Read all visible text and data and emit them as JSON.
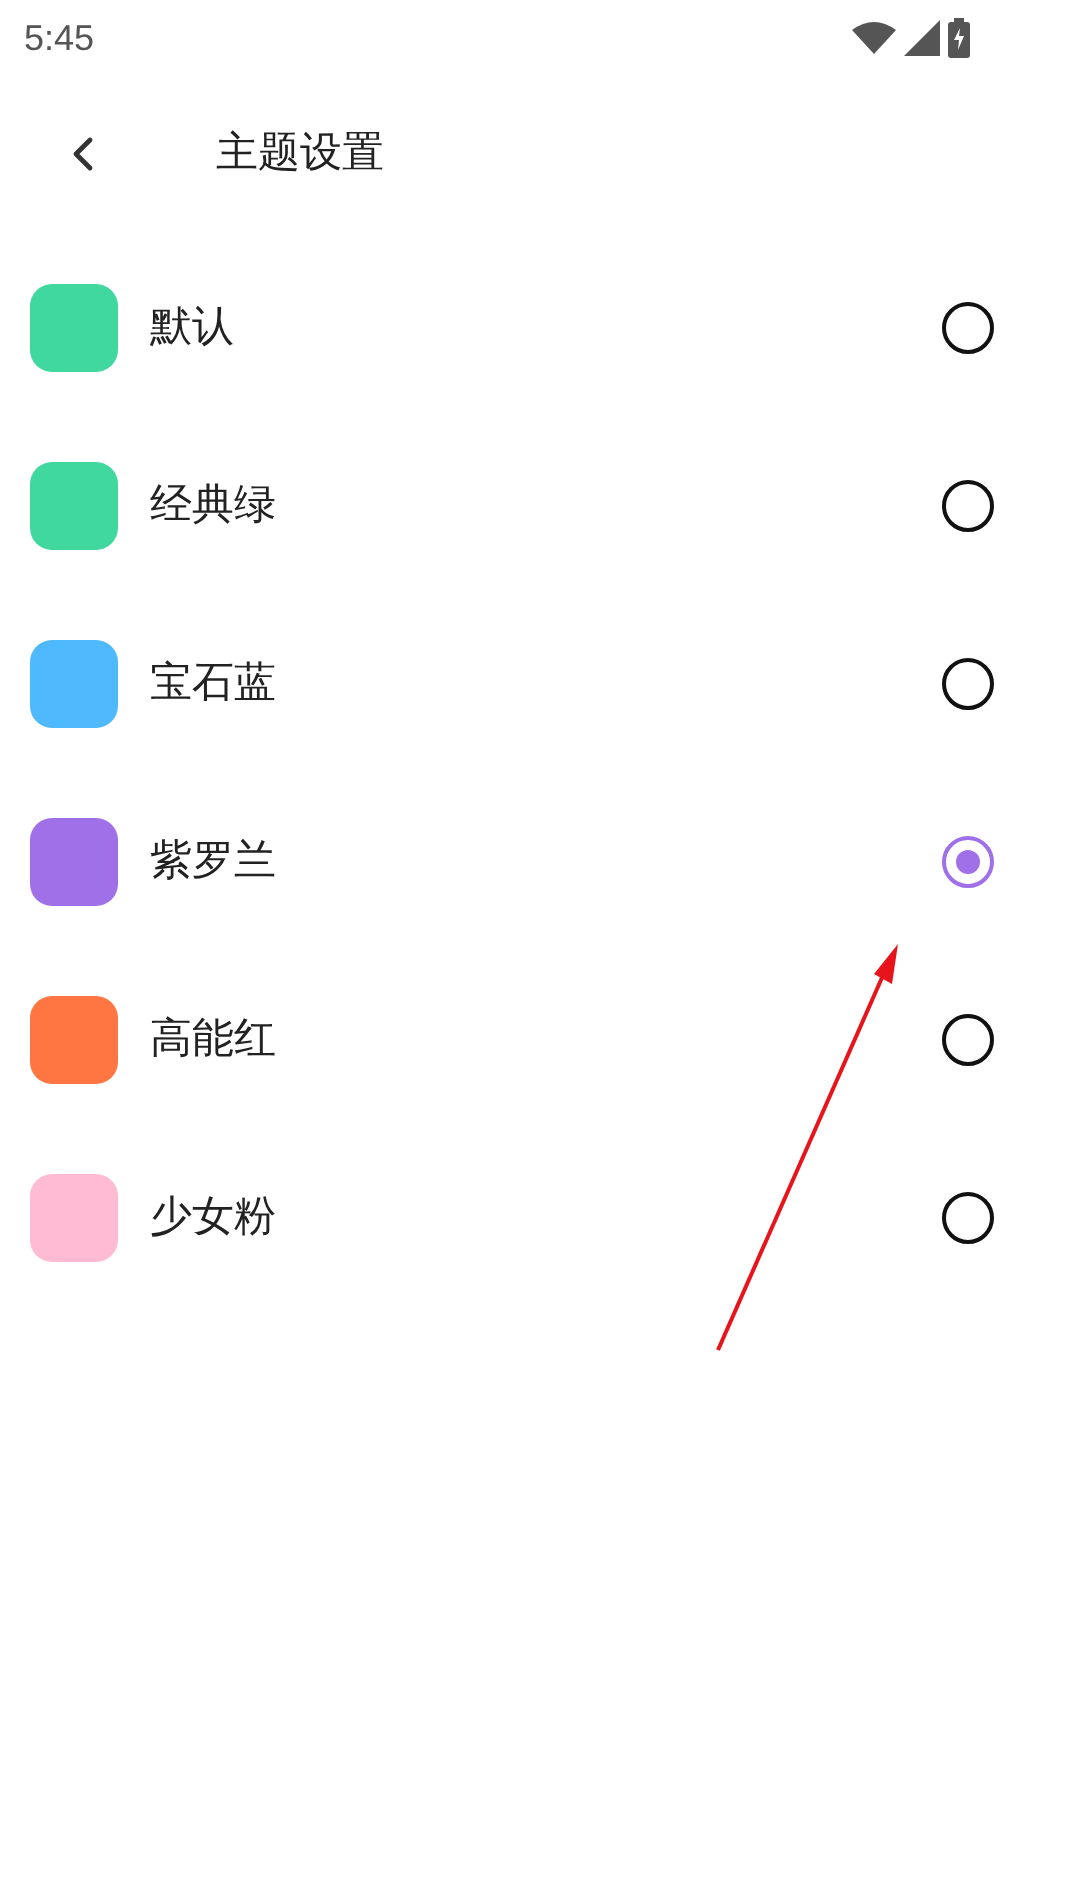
{
  "status_bar": {
    "time": "5:45"
  },
  "header": {
    "title": "主题设置"
  },
  "themes": [
    {
      "label": "默认",
      "color": "#41d89f",
      "selected": false
    },
    {
      "label": "经典绿",
      "color": "#41d89f",
      "selected": false
    },
    {
      "label": "宝石蓝",
      "color": "#4fb9fd",
      "selected": false
    },
    {
      "label": "紫罗兰",
      "color": "#a070e8",
      "selected": true
    },
    {
      "label": "高能红",
      "color": "#ff7643",
      "selected": false
    },
    {
      "label": "少女粉",
      "color": "#ffbbd3",
      "selected": false
    }
  ]
}
